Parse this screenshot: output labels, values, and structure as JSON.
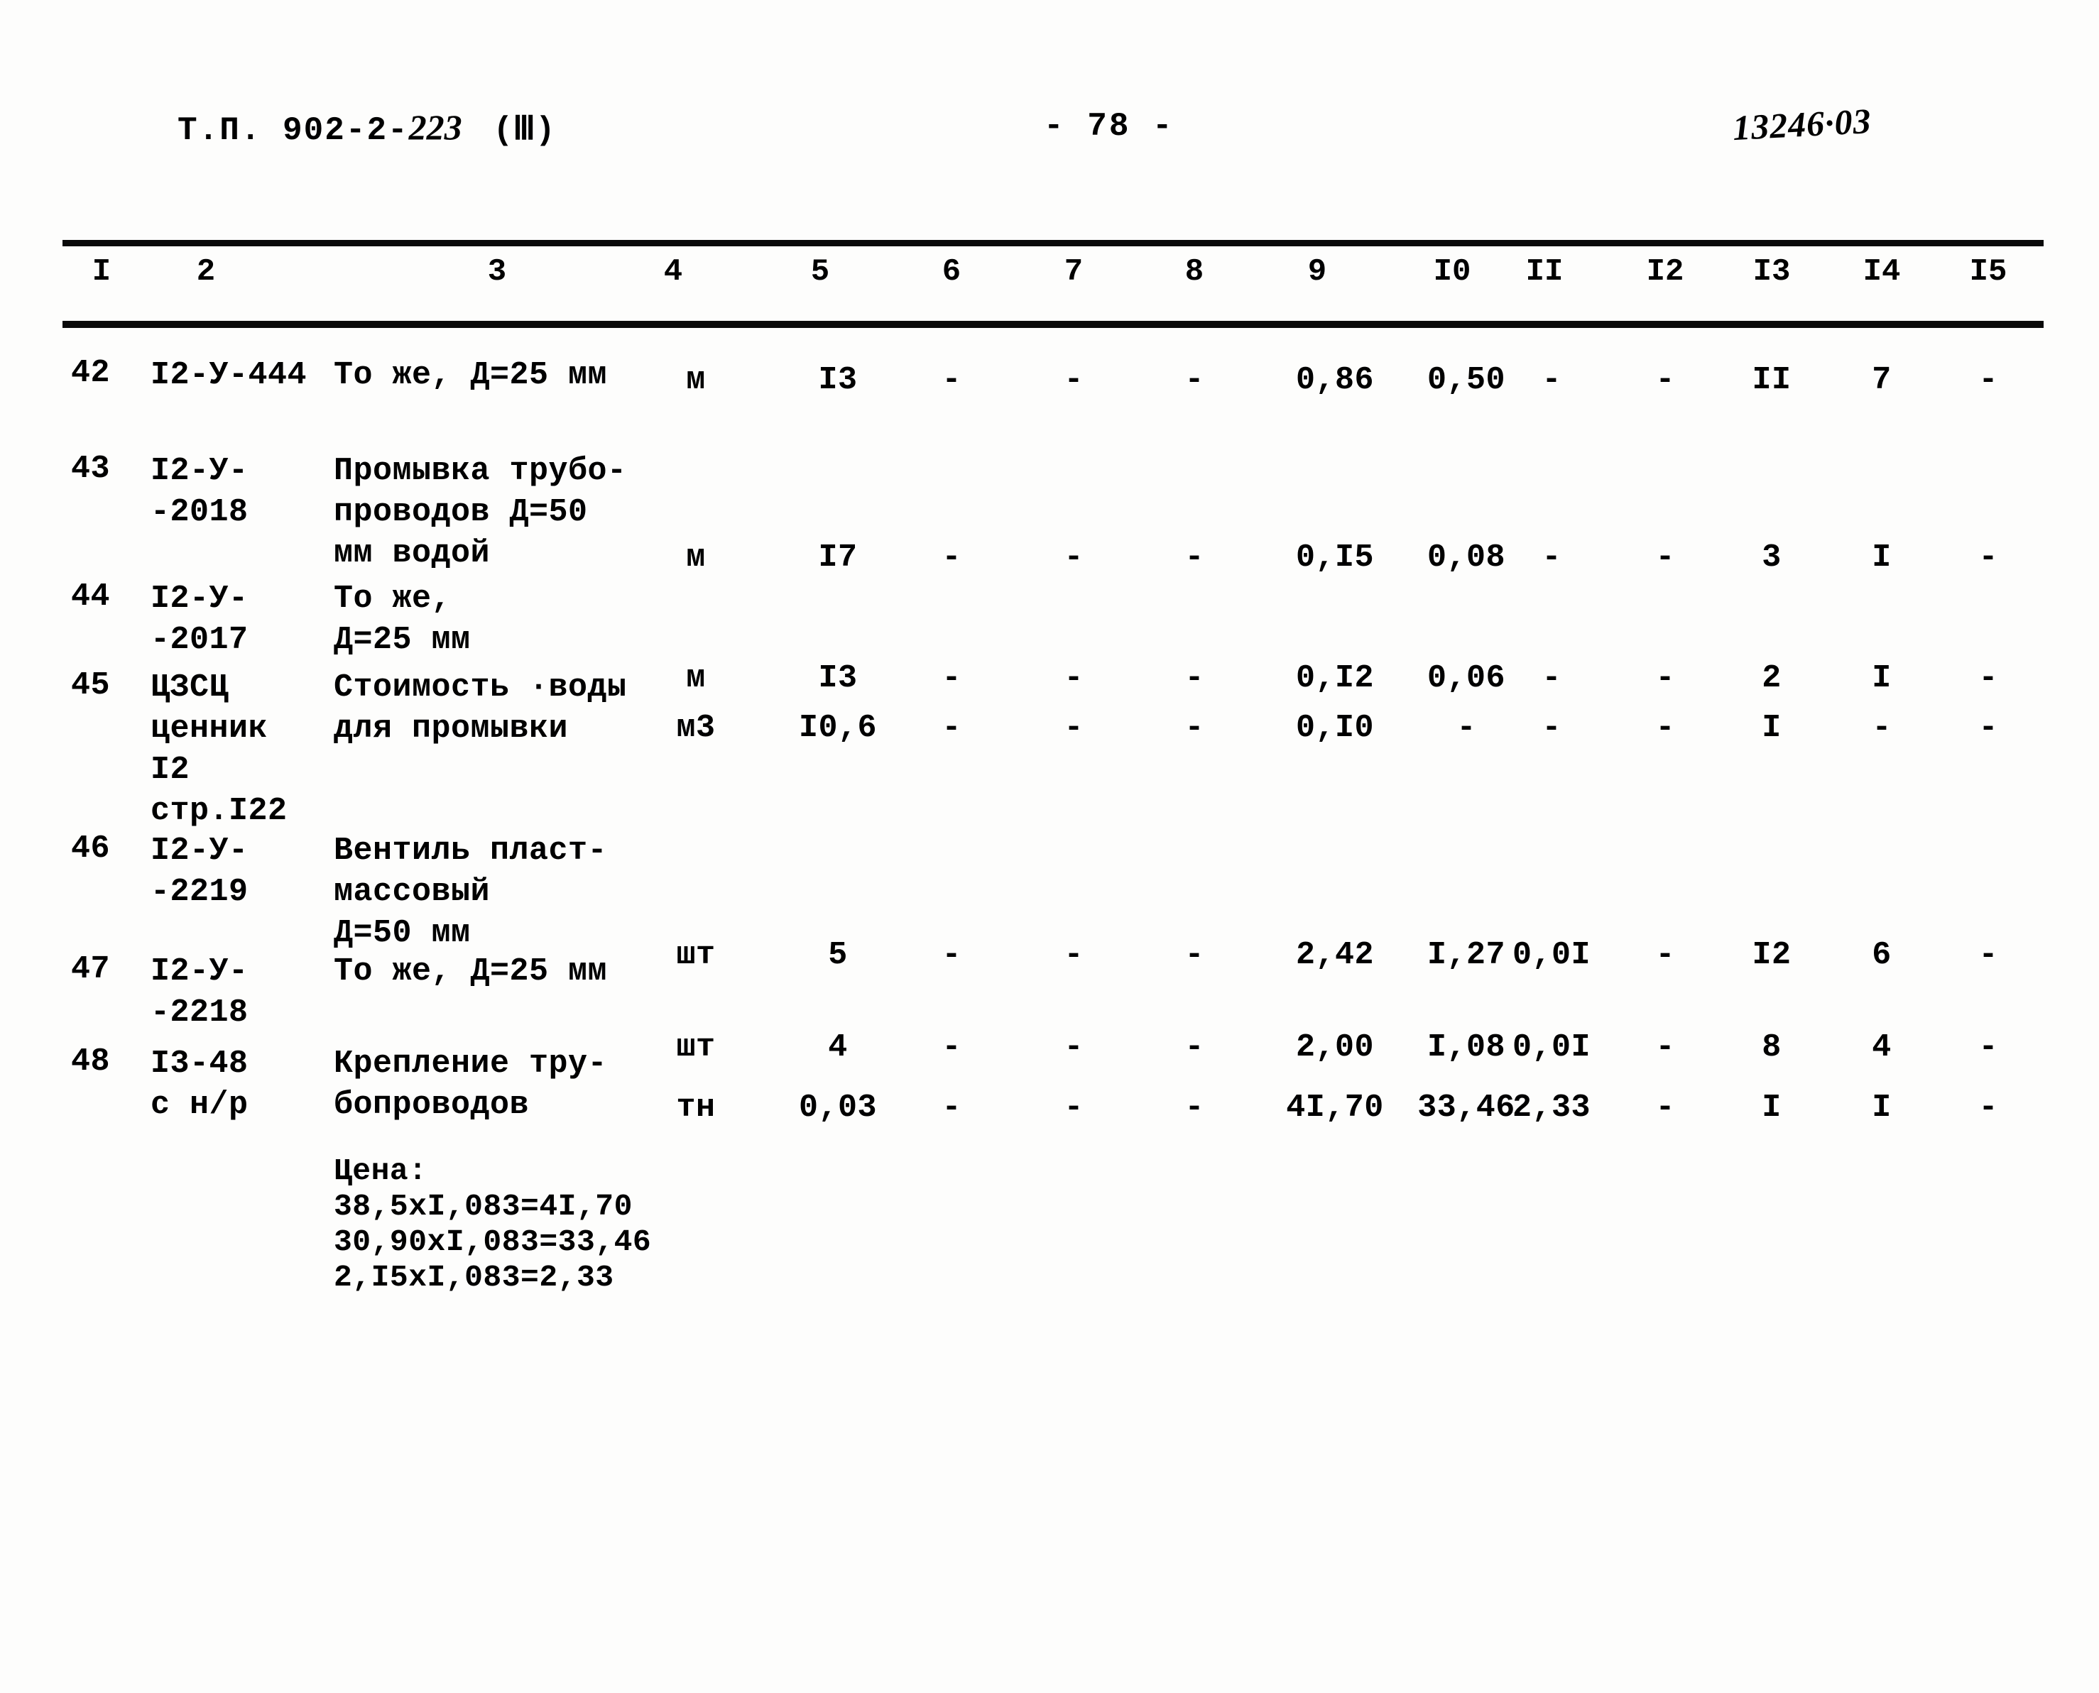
{
  "header": {
    "doc_prefix": "Т.П. 902-2-",
    "doc_number": "223",
    "series": "(Ⅲ)",
    "page_label": "- 78 -",
    "archive_code": "13246·03"
  },
  "table": {
    "column_headers": [
      "I",
      "2",
      "3",
      "4",
      "5",
      "6",
      "7",
      "8",
      "9",
      "I0",
      "II",
      "I2",
      "I3",
      "I4",
      "I5"
    ],
    "rows": [
      {
        "num": "42",
        "code_lines": [
          "I2-У-444"
        ],
        "desc_lines": [
          "То же, Д=25 мм"
        ],
        "unit": "м",
        "values": [
          "I3",
          "-",
          "-",
          "-",
          "0,86",
          "0,50",
          "-",
          "-",
          "II",
          "7",
          "-"
        ]
      },
      {
        "num": "43",
        "code_lines": [
          "I2-У-",
          "-2018"
        ],
        "desc_lines": [
          "Промывка трубо-",
          "проводов Д=50",
          "мм водой"
        ],
        "unit": "м",
        "values": [
          "I7",
          "-",
          "-",
          "-",
          "0,I5",
          "0,08",
          "-",
          "-",
          "3",
          "I",
          "-"
        ]
      },
      {
        "num": "44",
        "code_lines": [
          "I2-У-",
          "-2017"
        ],
        "desc_lines": [
          "То же,",
          "Д=25 мм"
        ],
        "unit": "м",
        "values": [
          "I3",
          "-",
          "-",
          "-",
          "0,I2",
          "0,06",
          "-",
          "-",
          "2",
          "I",
          "-"
        ]
      },
      {
        "num": "45",
        "code_lines": [
          "ЦЗСЦ",
          "ценник",
          "I2",
          "стр.I22"
        ],
        "desc_lines": [
          "Стоимость ·воды",
          "для промывки"
        ],
        "unit": "м3",
        "values": [
          "I0,6",
          "-",
          "-",
          "-",
          "0,I0",
          "-",
          "-",
          "-",
          "I",
          "-",
          "-"
        ]
      },
      {
        "num": "46",
        "code_lines": [
          "I2-У-",
          "-2219"
        ],
        "desc_lines": [
          "Вентиль пласт-",
          "массовый",
          "Д=50 мм"
        ],
        "unit": "шт",
        "values": [
          "5",
          "-",
          "-",
          "-",
          "2,42",
          "I,27",
          "0,0I",
          "-",
          "I2",
          "6",
          "-"
        ]
      },
      {
        "num": "47",
        "code_lines": [
          "I2-У-",
          "-2218"
        ],
        "desc_lines": [
          "То же, Д=25 мм"
        ],
        "unit": "шт",
        "values": [
          "4",
          "-",
          "-",
          "-",
          "2,00",
          "I,08",
          "0,0I",
          "-",
          "8",
          "4",
          "-"
        ]
      },
      {
        "num": "48",
        "code_lines": [
          "I3-48",
          "с н/р"
        ],
        "desc_lines": [
          "Крепление тру-",
          "бопроводов"
        ],
        "unit": "тн",
        "values": [
          "0,03",
          "-",
          "-",
          "-",
          "4I,70",
          "33,46",
          "2,33",
          "-",
          "I",
          "I",
          "-"
        ],
        "note_lines": [
          "Цена:",
          "38,5xI,083=4I,70",
          "30,90xI,083=33,46",
          "2,I5xI,083=2,33"
        ]
      }
    ]
  }
}
